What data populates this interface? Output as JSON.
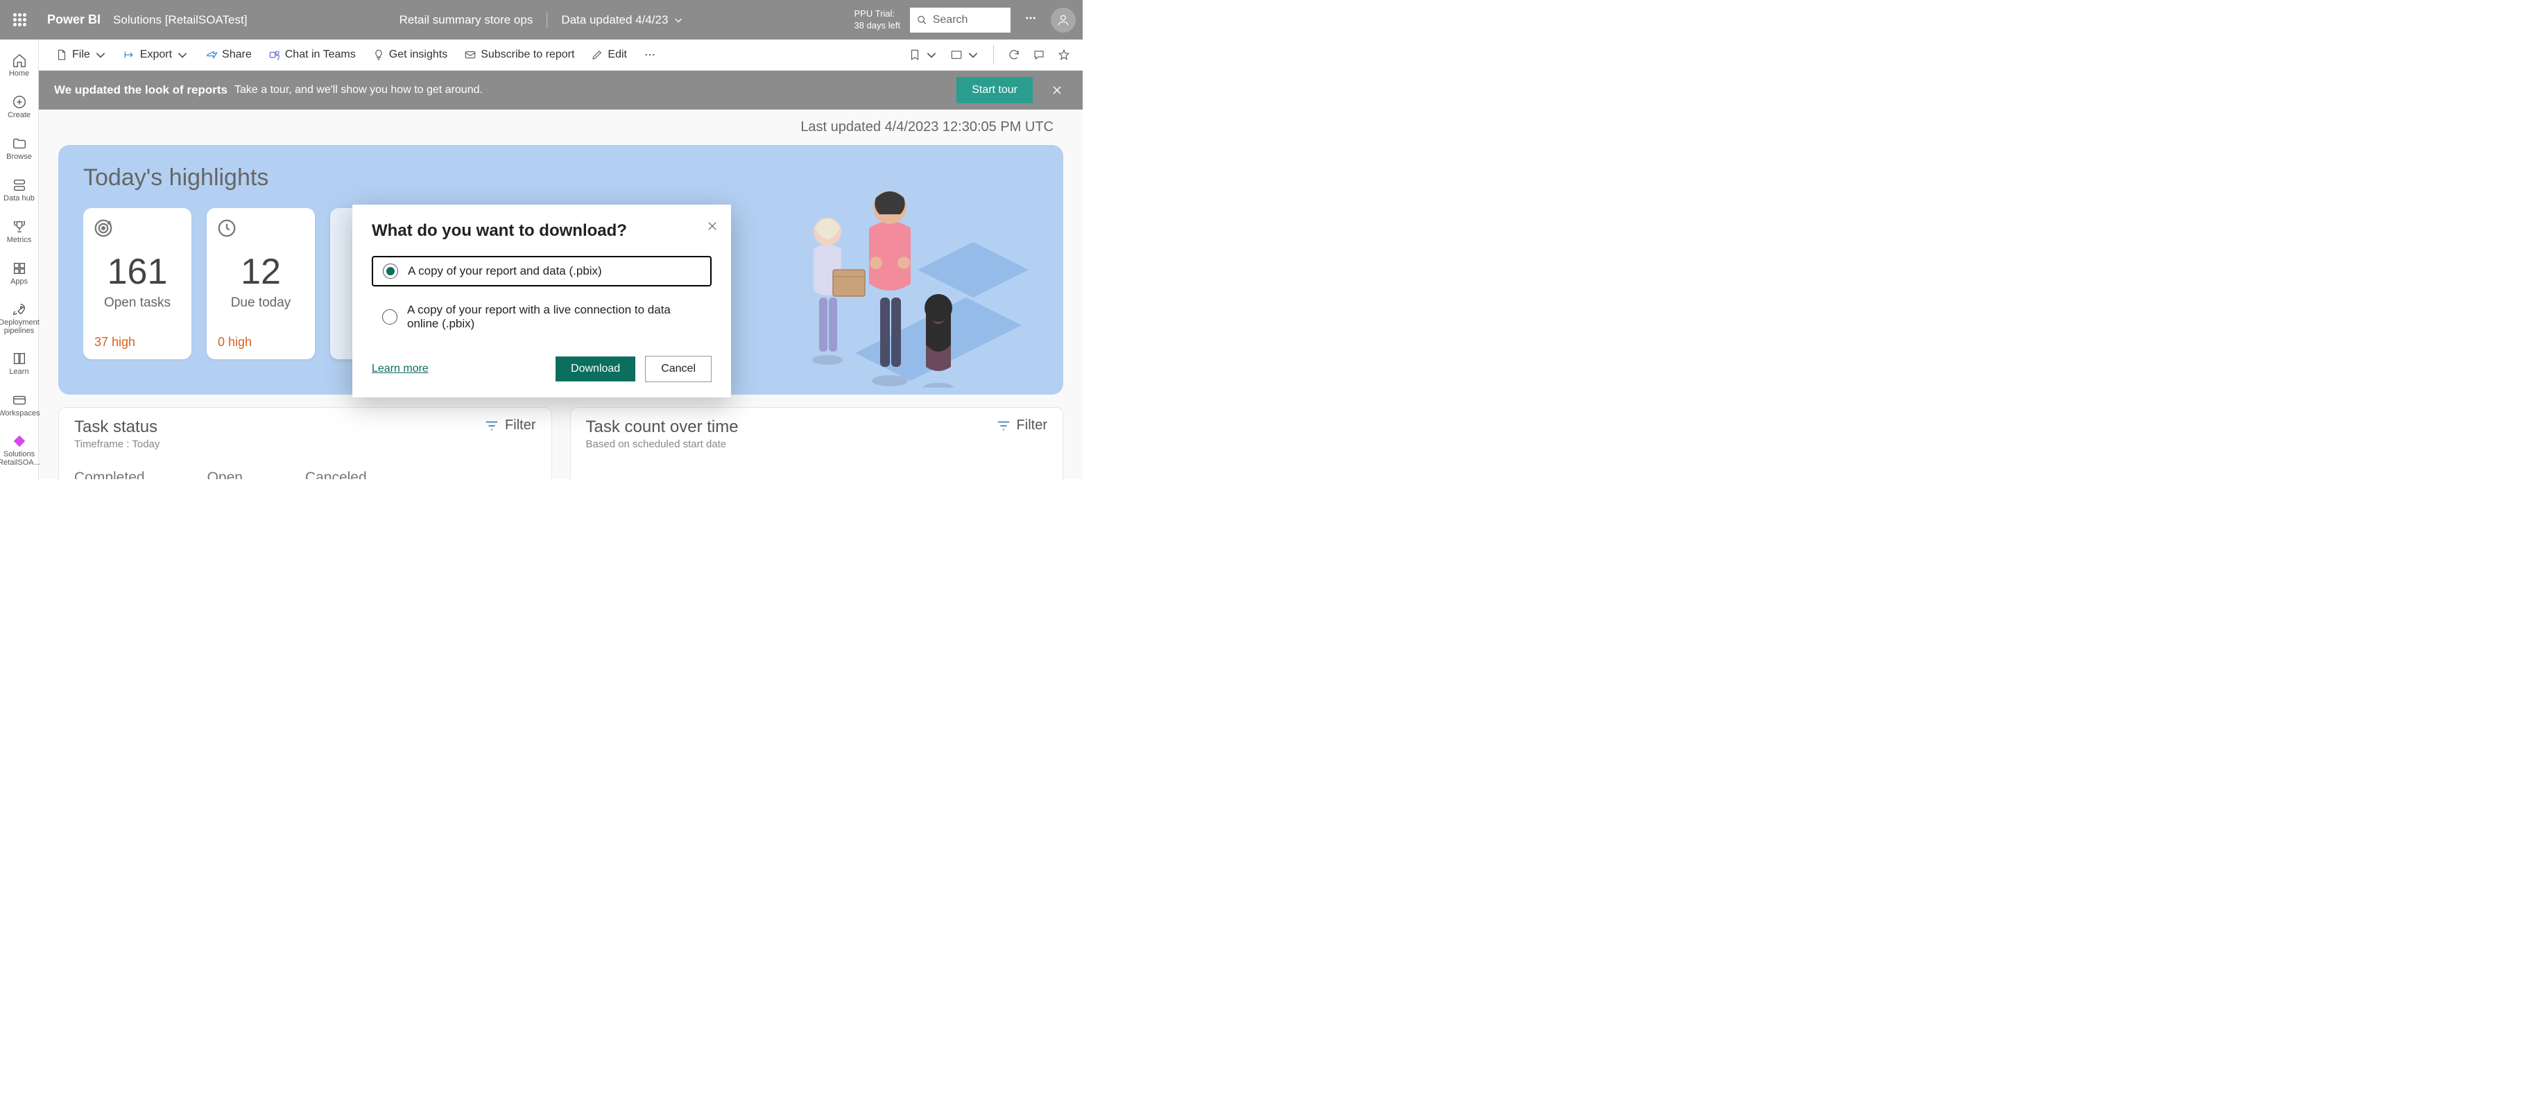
{
  "header": {
    "brand": "Power BI",
    "workspace": "Solutions [RetailSOATest]",
    "reportTitle": "Retail summary store ops",
    "dataUpdated": "Data updated 4/4/23",
    "trialLine1": "PPU Trial:",
    "trialLine2": "38 days left",
    "searchPlaceholder": "Search"
  },
  "navRail": {
    "items": [
      {
        "label": "Home"
      },
      {
        "label": "Create"
      },
      {
        "label": "Browse"
      },
      {
        "label": "Data hub"
      },
      {
        "label": "Metrics"
      },
      {
        "label": "Apps"
      },
      {
        "label": "Deployment pipelines"
      },
      {
        "label": "Learn"
      },
      {
        "label": "Workspaces"
      },
      {
        "label": "Solutions RetailSOA..."
      }
    ]
  },
  "toolbar": {
    "file": "File",
    "export": "Export",
    "share": "Share",
    "chatTeams": "Chat in Teams",
    "getInsights": "Get insights",
    "subscribe": "Subscribe to report",
    "edit": "Edit"
  },
  "tourBanner": {
    "bold": "We updated the look of reports",
    "text": "Take a tour, and we'll show you how to get around.",
    "startBtn": "Start tour"
  },
  "content": {
    "lastUpdated": "Last updated 4/4/2023 12:30:05 PM UTC",
    "heroTitle": "Today's highlights",
    "cards": [
      {
        "num": "161",
        "label": "Open tasks",
        "sub": "37 high"
      },
      {
        "num": "12",
        "label": "Due today",
        "sub": "0 high"
      }
    ],
    "panel1": {
      "title": "Task status",
      "sub": "Timeframe : Today",
      "filter": "Filter",
      "col1": "Completed",
      "col2": "Open",
      "col3": "Canceled"
    },
    "panel2": {
      "title": "Task count over time",
      "sub": "Based on scheduled start date",
      "filter": "Filter"
    }
  },
  "dialog": {
    "title": "What do you want to download?",
    "option1": "A copy of your report and data (.pbix)",
    "option2": "A copy of your report with a live connection to data online (.pbix)",
    "learnMore": "Learn more",
    "download": "Download",
    "cancel": "Cancel"
  }
}
